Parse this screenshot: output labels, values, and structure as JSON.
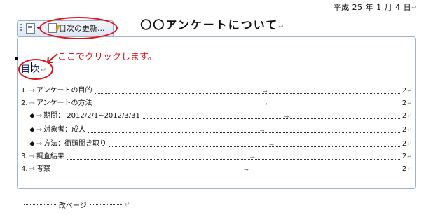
{
  "header": {
    "date": "平成 25 年 1 月 4 日",
    "date_mark": "↵"
  },
  "document": {
    "title": "〇〇アンケートについて",
    "title_mark": "↵"
  },
  "content_control": {
    "update_label": "目次の更新...",
    "heading": "目次",
    "heading_mark": "↵",
    "callout": "ここでクリックします。"
  },
  "toc": [
    {
      "number": "1.",
      "label": "アンケートの目的",
      "page": "2",
      "level": 1
    },
    {
      "number": "2.",
      "label": "アンケートの方法",
      "page": "2",
      "level": 1
    },
    {
      "number": "◆",
      "label": "期間： 2012/2/1~2012/3/31",
      "page": "2",
      "level": 2
    },
    {
      "number": "◆",
      "label": "対象者：成人",
      "page": "2",
      "level": 2
    },
    {
      "number": "◆",
      "label": "方法：街頭聞き取り",
      "page": "2",
      "level": 2
    },
    {
      "number": "3.",
      "label": "調査結果",
      "page": "2",
      "level": 1
    },
    {
      "number": "4.",
      "label": "考察",
      "page": "2",
      "level": 1
    }
  ],
  "toc_marks": {
    "tab_arrow": "→",
    "end_mark": "↵"
  },
  "page_break": {
    "label": "改ページ",
    "mark": "↵"
  },
  "colors": {
    "annotation": "#e0141b",
    "control_border": "#9fb2c8",
    "heading": "#1a1f6b"
  }
}
